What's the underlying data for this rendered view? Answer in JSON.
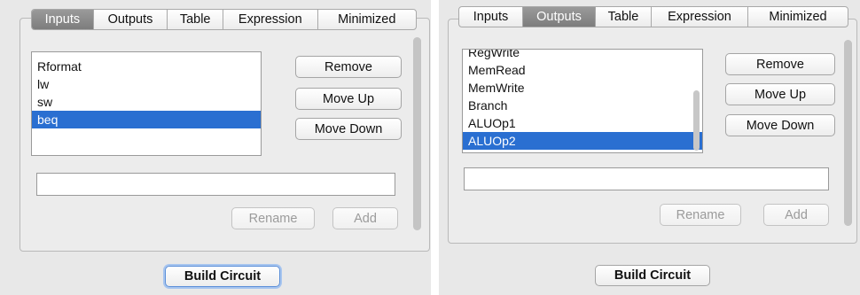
{
  "left_window": {
    "tabs": [
      {
        "label": "Inputs",
        "selected": true
      },
      {
        "label": "Outputs",
        "selected": false
      },
      {
        "label": "Table",
        "selected": false
      },
      {
        "label": "Expression",
        "selected": false
      },
      {
        "label": "Minimized",
        "selected": false
      }
    ],
    "list_items": [
      {
        "label": "Rformat",
        "selected": false
      },
      {
        "label": "lw",
        "selected": false
      },
      {
        "label": "sw",
        "selected": false
      },
      {
        "label": "beq",
        "selected": true
      }
    ],
    "buttons": {
      "remove": "Remove",
      "move_up": "Move Up",
      "move_down": "Move Down",
      "rename": "Rename",
      "add": "Add",
      "build": "Build Circuit"
    },
    "name_field_value": ""
  },
  "right_window": {
    "tabs": [
      {
        "label": "Inputs",
        "selected": false
      },
      {
        "label": "Outputs",
        "selected": true
      },
      {
        "label": "Table",
        "selected": false
      },
      {
        "label": "Expression",
        "selected": false
      },
      {
        "label": "Minimized",
        "selected": false
      }
    ],
    "list_items": [
      {
        "label": "RegWrite",
        "selected": false
      },
      {
        "label": "MemRead",
        "selected": false
      },
      {
        "label": "MemWrite",
        "selected": false
      },
      {
        "label": "Branch",
        "selected": false
      },
      {
        "label": "ALUOp1",
        "selected": false
      },
      {
        "label": "ALUOp2",
        "selected": true
      }
    ],
    "buttons": {
      "remove": "Remove",
      "move_up": "Move Up",
      "move_down": "Move Down",
      "rename": "Rename",
      "add": "Add",
      "build": "Build Circuit"
    },
    "name_field_value": ""
  },
  "colors": {
    "selection": "#2a6fd1",
    "selected_tab": "#888888",
    "window_bg": "#e8e8e8"
  }
}
